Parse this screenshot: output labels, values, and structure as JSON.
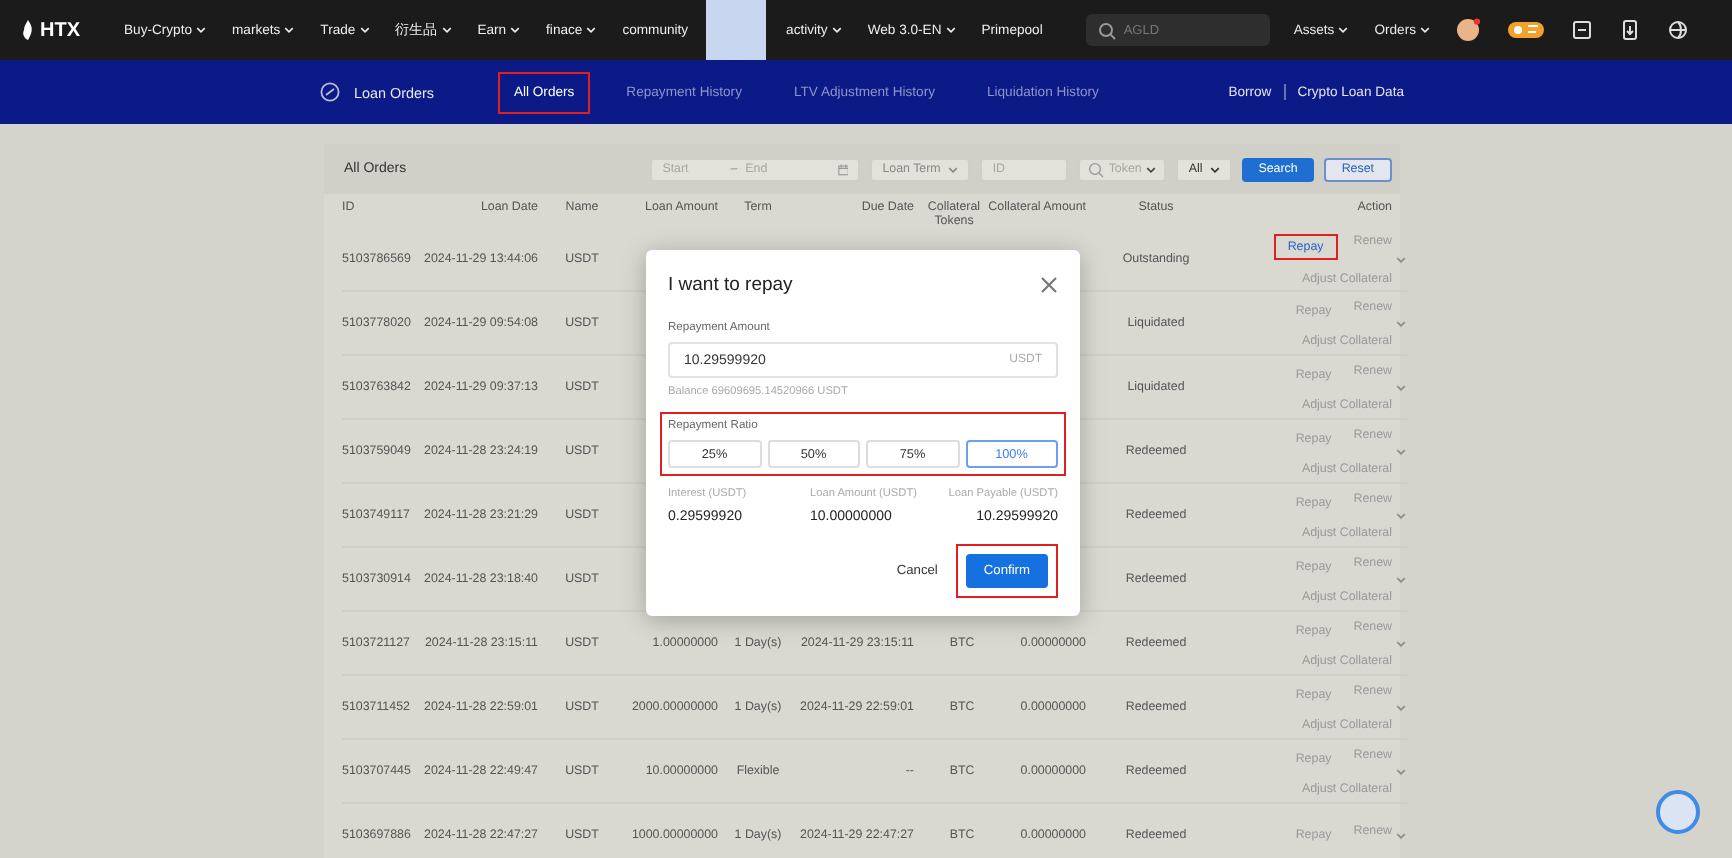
{
  "topbar": {
    "logo": "HTX",
    "menu": [
      {
        "label": "Buy-Crypto",
        "caret": true
      },
      {
        "label": "markets",
        "caret": true
      },
      {
        "label": "Trade",
        "caret": true
      },
      {
        "label": "衍生品",
        "caret": true
      },
      {
        "label": "Earn",
        "caret": true
      },
      {
        "label": "finace",
        "caret": true
      },
      {
        "label": "community",
        "caret": false
      },
      {
        "label": "activity",
        "caret": true
      },
      {
        "label": "Web 3.0-EN",
        "caret": true
      },
      {
        "label": "Primepool",
        "caret": false
      }
    ],
    "search": {
      "placeholder": "AGLD"
    },
    "right_menu": [
      {
        "label": "Assets"
      },
      {
        "label": "Orders"
      }
    ]
  },
  "subnav": {
    "title": "Loan Orders",
    "tabs": [
      {
        "label": "All Orders",
        "selected": true,
        "highlighted": true
      },
      {
        "label": "Repayment History",
        "selected": false,
        "highlighted": false
      },
      {
        "label": "LTV Adjustment History",
        "selected": false,
        "highlighted": false
      },
      {
        "label": "Liquidation History",
        "selected": false,
        "highlighted": false
      }
    ],
    "links": [
      "Borrow",
      "Crypto Loan Data"
    ]
  },
  "filters": {
    "title": "All Orders",
    "start": {
      "placeholder": "Start"
    },
    "separator": "–",
    "end": {
      "placeholder": "End"
    },
    "loan_term": "Loan Term",
    "id": {
      "placeholder": "ID"
    },
    "token": {
      "placeholder": "Token"
    },
    "all": "All",
    "search_button": "Search",
    "reset_button": "Reset"
  },
  "table": {
    "columns": [
      "ID",
      "Loan Date",
      "Name",
      "Loan Amount",
      "Term",
      "Due Date",
      "Collateral Tokens",
      "Collateral Amount",
      "Status",
      "Action"
    ],
    "rows": [
      {
        "cells": [
          "5103786569",
          "2024-11-29 13:44:06",
          "USDT",
          null,
          null,
          null,
          null,
          null,
          "Outstanding"
        ],
        "actions": {
          "repay": "Repay",
          "renew": "Renew",
          "adjust": "Adjust Collateral"
        },
        "repay_enabled": true,
        "repay_highlighted": true
      },
      {
        "cells": [
          "5103778020",
          "2024-11-29 09:54:08",
          "USDT",
          null,
          null,
          null,
          null,
          null,
          "Liquidated"
        ],
        "actions": {
          "repay": "Repay",
          "renew": "Renew",
          "adjust": "Adjust Collateral"
        },
        "repay_enabled": false,
        "repay_highlighted": false
      },
      {
        "cells": [
          "5103763842",
          "2024-11-29 09:37:13",
          "USDT",
          null,
          null,
          null,
          null,
          null,
          "Liquidated"
        ],
        "actions": {
          "repay": "Repay",
          "renew": "Renew",
          "adjust": "Adjust Collateral"
        },
        "repay_enabled": false,
        "repay_highlighted": false
      },
      {
        "cells": [
          "5103759049",
          "2024-11-28 23:24:19",
          "USDT",
          null,
          null,
          null,
          null,
          null,
          "Redeemed"
        ],
        "actions": {
          "repay": "Repay",
          "renew": "Renew",
          "adjust": "Adjust Collateral"
        },
        "repay_enabled": false,
        "repay_highlighted": false
      },
      {
        "cells": [
          "5103749117",
          "2024-11-28 23:21:29",
          "USDT",
          null,
          null,
          null,
          null,
          null,
          "Redeemed"
        ],
        "actions": {
          "repay": "Repay",
          "renew": "Renew",
          "adjust": "Adjust Collateral"
        },
        "repay_enabled": false,
        "repay_highlighted": false
      },
      {
        "cells": [
          "5103730914",
          "2024-11-28 23:18:40",
          "USDT",
          null,
          null,
          null,
          null,
          null,
          "Redeemed"
        ],
        "actions": {
          "repay": "Repay",
          "renew": "Renew",
          "adjust": "Adjust Collateral"
        },
        "repay_enabled": false,
        "repay_highlighted": false
      },
      {
        "cells": [
          "5103721127",
          "2024-11-28 23:15:11",
          "USDT",
          "1.00000000",
          "1 Day(s)",
          "2024-11-29 23:15:11",
          "BTC",
          "0.00000000",
          "Redeemed"
        ],
        "actions": {
          "repay": "Repay",
          "renew": "Renew",
          "adjust": "Adjust Collateral"
        },
        "repay_enabled": false,
        "repay_highlighted": false
      },
      {
        "cells": [
          "5103711452",
          "2024-11-28 22:59:01",
          "USDT",
          "2000.00000000",
          "1 Day(s)",
          "2024-11-29 22:59:01",
          "BTC",
          "0.00000000",
          "Redeemed"
        ],
        "actions": {
          "repay": "Repay",
          "renew": "Renew",
          "adjust": "Adjust Collateral"
        },
        "repay_enabled": false,
        "repay_highlighted": false
      },
      {
        "cells": [
          "5103707445",
          "2024-11-28 22:49:47",
          "USDT",
          "10.00000000",
          "Flexible",
          "--",
          "BTC",
          "0.00000000",
          "Redeemed"
        ],
        "actions": {
          "repay": "Repay",
          "renew": "Renew",
          "adjust": "Adjust Collateral"
        },
        "repay_enabled": false,
        "repay_highlighted": false
      },
      {
        "cells": [
          "5103697886",
          "2024-11-28 22:47:27",
          "USDT",
          "1000.00000000",
          "1 Day(s)",
          "2024-11-29 22:47:27",
          "BTC",
          "0.00000000",
          "Redeemed"
        ],
        "actions": {
          "repay": "Repay",
          "renew": "Renew"
        },
        "repay_enabled": false,
        "repay_highlighted": false
      }
    ]
  },
  "modal": {
    "title": "I want to repay",
    "amount_label": "Repayment Amount",
    "amount_value": "10.29599920",
    "amount_unit": "USDT",
    "balance": "Balance 69609695.14520966 USDT",
    "ratio_label": "Repayment Ratio",
    "ratio_highlighted": true,
    "ratios": [
      {
        "label": "25%",
        "selected": false
      },
      {
        "label": "50%",
        "selected": false
      },
      {
        "label": "75%",
        "selected": false
      },
      {
        "label": "100%",
        "selected": true
      }
    ],
    "summary": [
      {
        "label": "Interest (USDT)",
        "value": "0.29599920"
      },
      {
        "label": "Loan Amount (USDT)",
        "value": "10.00000000"
      },
      {
        "label": "Loan Payable (USDT)",
        "value": "10.29599920"
      }
    ],
    "cancel": "Cancel",
    "confirm": "Confirm",
    "confirm_highlighted": true
  }
}
